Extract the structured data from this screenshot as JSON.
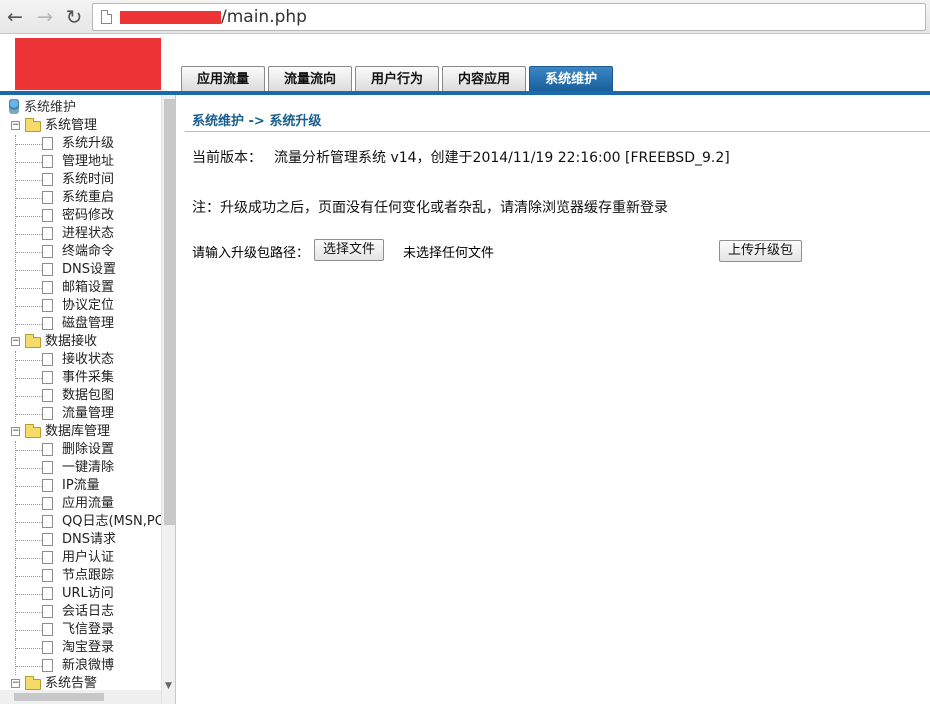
{
  "browser": {
    "url_path": "/main.php"
  },
  "header": {
    "tabs": [
      {
        "label": "应用流量",
        "active": false
      },
      {
        "label": "流量流向",
        "active": false
      },
      {
        "label": "用户行为",
        "active": false
      },
      {
        "label": "内容应用",
        "active": false
      },
      {
        "label": "系统维护",
        "active": true
      }
    ],
    "colors": {
      "accent": "#1b6aa9",
      "redaction": "#ef3438"
    }
  },
  "sidebar": {
    "root": "系统维护",
    "groups": [
      {
        "label": "系统管理",
        "expanded": true,
        "items": [
          "系统升级",
          "管理地址",
          "系统时间",
          "系统重启",
          "密码修改",
          "进程状态",
          "终端命令",
          "DNS设置",
          "邮箱设置",
          "协议定位",
          "磁盘管理"
        ]
      },
      {
        "label": "数据接收",
        "expanded": true,
        "items": [
          "接收状态",
          "事件采集",
          "数据包图",
          "流量管理"
        ]
      },
      {
        "label": "数据库管理",
        "expanded": true,
        "items": [
          "删除设置",
          "一键清除",
          "IP流量",
          "应用流量",
          "QQ日志(MSN,POI",
          "DNS请求",
          "用户认证",
          "节点跟踪",
          "URL访问",
          "会话日志",
          "飞信登录",
          "淘宝登录",
          "新浪微博"
        ]
      },
      {
        "label": "系统告警",
        "expanded": true,
        "items": []
      }
    ]
  },
  "main": {
    "breadcrumb": "系统维护 -> 系统升级",
    "version_label": "当前版本：",
    "version_value": "流量分析管理系统 v14，创建于2014/11/19 22:16:00 [FREEBSD_9.2]",
    "note": "注：升级成功之后，页面没有任何变化或者杂乱，请清除浏览器缓存重新登录",
    "upload_label": "请输入升级包路径：",
    "choose_file_button": "选择文件",
    "no_file_text": "未选择任何文件",
    "upload_button": "上传升级包"
  }
}
